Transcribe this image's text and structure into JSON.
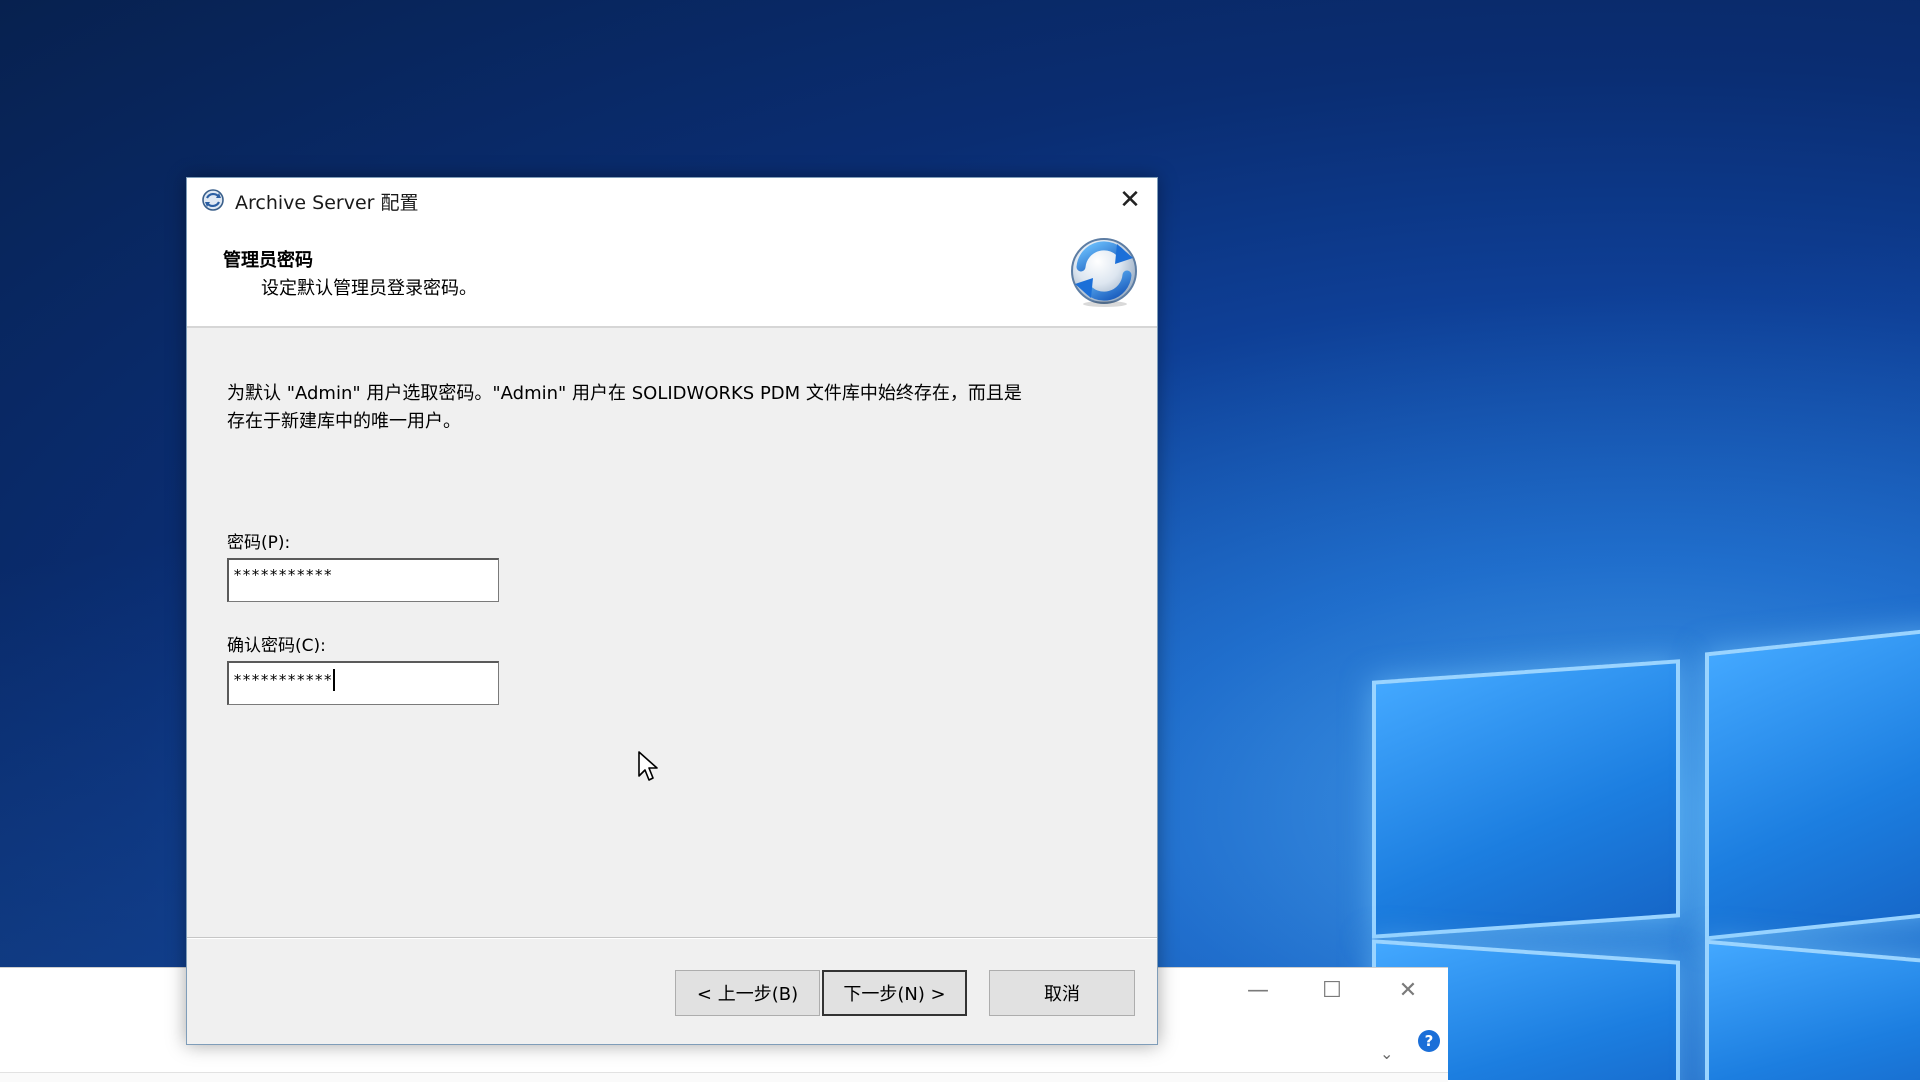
{
  "dialog": {
    "title": "Archive Server 配置",
    "header_title": "管理员密码",
    "header_subtitle": "设定默认管理员登录密码。",
    "description_line1": "为默认 \"Admin\" 用户选取密码。\"Admin\" 用户在 SOLIDWORKS PDM 文件库中始终存在，而且是",
    "description_line2": "存在于新建库中的唯一用户。",
    "password_label": "密码(P):",
    "password_value": "***********",
    "confirm_label": "确认密码(C):",
    "confirm_value": "***********",
    "back_button": "< 上一步(B)",
    "next_button": "下一步(N) >",
    "cancel_button": "取消",
    "close_glyph": "✕"
  },
  "background_window": {
    "minimize_glyph": "—",
    "maximize_glyph": "☐",
    "close_glyph": "✕",
    "expand_glyph": "⌄",
    "help_glyph": "?"
  },
  "colors": {
    "accent": "#1b6fd8",
    "dialog_bg": "#f0f0f0",
    "header_bg": "#ffffff"
  }
}
